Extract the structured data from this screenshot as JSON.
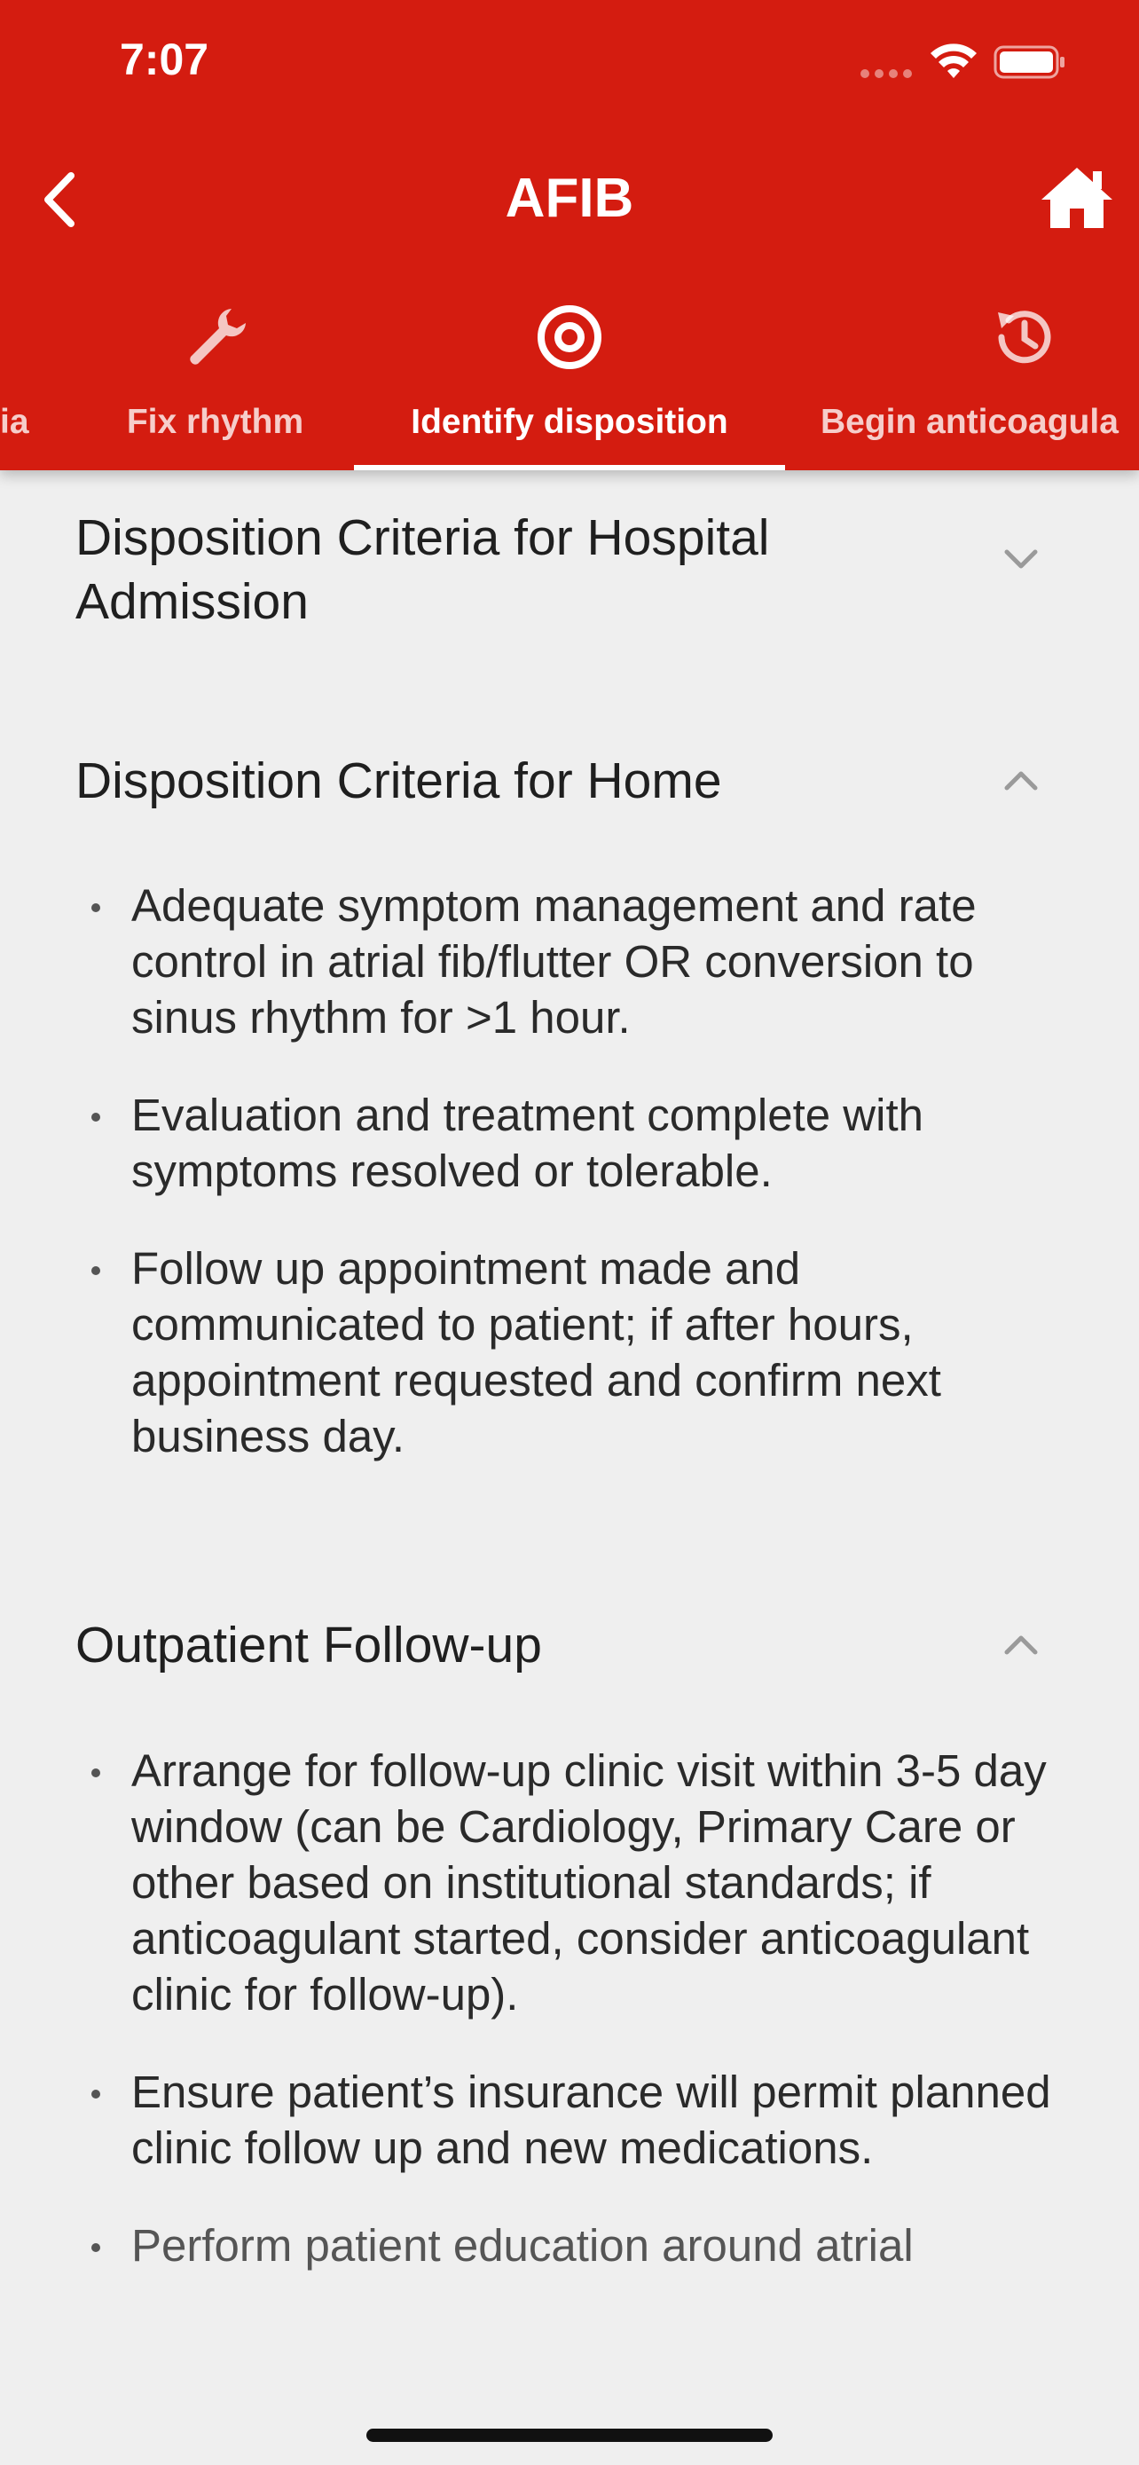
{
  "status_bar": {
    "time": "7:07"
  },
  "nav": {
    "title": "AFIB"
  },
  "tabs": [
    {
      "label": "ia",
      "icon": "pulse-icon",
      "active": false
    },
    {
      "label": "Fix rhythm",
      "icon": "wrench-icon",
      "active": false
    },
    {
      "label": "Identify disposition",
      "icon": "target-icon",
      "active": true
    },
    {
      "label": "Begin anticoagula",
      "icon": "history-clock-icon",
      "active": false
    }
  ],
  "colors": {
    "header": "#d41c10",
    "background": "#efefef",
    "text": "#1f1f1f",
    "chevron": "#9a9a9a"
  },
  "sections": [
    {
      "title": "Disposition Criteria for Hospital Admission",
      "expanded": false,
      "items": []
    },
    {
      "title": "Disposition Criteria for Home",
      "expanded": true,
      "items": [
        "Adequate symptom management and rate control in atrial fib/flutter OR conversion to sinus rhythm for >1 hour.",
        "Evaluation and treatment complete with symptoms resolved or tolerable.",
        "Follow up appointment made and communicated to patient; if after hours, appointment requested and confirm next business day."
      ]
    },
    {
      "title": "Outpatient Follow-up",
      "expanded": true,
      "items": [
        "Arrange for follow-up clinic visit within 3-5 day window (can be Cardiology, Primary Care or other based on institutional standards; if anticoagulant started, consider anticoagulant clinic for follow-up).",
        "Ensure patient’s insurance will permit planned clinic follow up and new medications.",
        "Perform patient education around atrial"
      ]
    }
  ]
}
